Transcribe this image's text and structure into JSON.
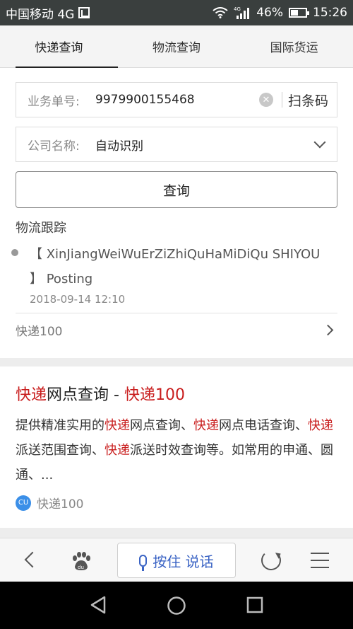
{
  "status_bar": {
    "carrier": "中国移动 4G",
    "network": "4G",
    "battery": "46%",
    "time": "15:26"
  },
  "tabs": [
    {
      "label": "快递查询",
      "active": true
    },
    {
      "label": "物流查询",
      "active": false
    },
    {
      "label": "国际货运",
      "active": false
    }
  ],
  "form": {
    "tracking_label": "业务单号:",
    "tracking_value": "9979900155468",
    "scan_label": "扫条码",
    "company_label": "公司名称:",
    "company_value": "自动识别",
    "query_button": "查询"
  },
  "tracking": {
    "section_title": "物流跟踪",
    "event_text": "【 XinJiangWeiWuErZiZhiQuHaMiDiQu SHIYOU 】 Posting",
    "event_time": "2018-09-14 12:10",
    "more_label": "快递100"
  },
  "result": {
    "title_part1": "快递",
    "title_part2": "网点查询 - ",
    "title_part3": "快递100",
    "desc": {
      "s1": "提供精准实用的",
      "k1": "快递",
      "s2": "网点查询、",
      "k2": "快递",
      "s3": "网点电话查询、",
      "k3": "快递",
      "s4": "派送范围查询、",
      "k4": "快递",
      "s5": "派送时效查询等。如常用的申通、圆通、..."
    },
    "source": "快递100",
    "source_logo_text": "CU"
  },
  "bottom_bar": {
    "voice_label": "按住 说话",
    "paw_text": "du"
  },
  "colors": {
    "highlight_red": "#c91e1e",
    "voice_blue": "#3a63c4",
    "status_bar_bg": "#3a3f3e"
  }
}
